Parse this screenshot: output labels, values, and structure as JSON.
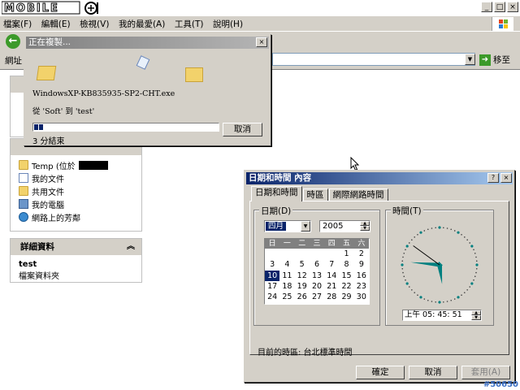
{
  "explorer": {
    "logo_text": "MOBILE",
    "menu": [
      "檔案(F)",
      "編輯(E)",
      "檢視(V)",
      "我的最愛(A)",
      "工具(T)",
      "說明(H)"
    ],
    "address_label": "網址",
    "go_label": "移至"
  },
  "panes": {
    "other_places": {
      "items": [
        {
          "icon": "folder-icon",
          "label": "Temp (位於"
        },
        {
          "icon": "document-icon",
          "label": "我的文件"
        },
        {
          "icon": "folder-icon",
          "label": "共用文件"
        },
        {
          "icon": "computer-icon",
          "label": "我的電腦"
        },
        {
          "icon": "network-icon",
          "label": "網路上的芳鄰"
        }
      ]
    },
    "details": {
      "title": "詳細資料",
      "name": "test",
      "type": "檔案資料夾"
    }
  },
  "copy_dialog": {
    "title": "正在複製...",
    "file_name": "WindowsXP-KB835935-SP2-CHT.exe",
    "from_to": "從 'Soft' 到 'test'",
    "remaining": "3 分結束",
    "progress_fraction": 0.04,
    "cancel_label": "取消"
  },
  "datetime_dialog": {
    "title": "日期和時間 內容",
    "help_btn": "?",
    "close_btn": "×",
    "tabs": [
      "日期和時間",
      "時區",
      "網際網路時間"
    ],
    "date_group": "日期(D)",
    "time_group": "時間(T)",
    "month": "四月",
    "year": "2005",
    "weekdays": [
      "日",
      "一",
      "二",
      "三",
      "四",
      "五",
      "六"
    ],
    "days": [
      "",
      "",
      "",
      "",
      "",
      "1",
      "2",
      "3",
      "4",
      "5",
      "6",
      "7",
      "8",
      "9",
      "10",
      "11",
      "12",
      "13",
      "14",
      "15",
      "16",
      "17",
      "18",
      "19",
      "20",
      "21",
      "22",
      "23",
      "24",
      "25",
      "26",
      "27",
      "28",
      "29",
      "30"
    ],
    "selected_day": "10",
    "time_value": "上午  05: 45: 51",
    "clock": {
      "hour": 5,
      "minute": 45,
      "second": 51
    },
    "timezone_text": "目前的時區: 台北標準時間",
    "ok_label": "確定",
    "cancel_label": "取消",
    "apply_label": "套用(A)"
  },
  "watermark": "#50650"
}
